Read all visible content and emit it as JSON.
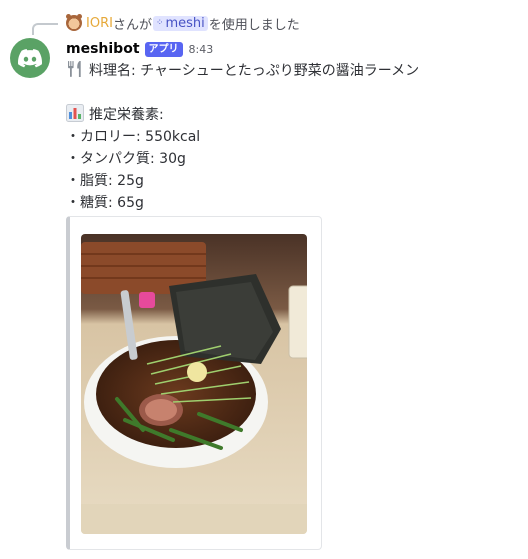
{
  "reply": {
    "user": "IORI",
    "text_before": "さんが",
    "command": "meshi",
    "text_after": "を使用しました"
  },
  "message": {
    "username": "meshibot",
    "badge": "アプリ",
    "timestamp": "8:43",
    "dish": "料理名: チャーシューとたっぷり野菜の醤油ラーメン",
    "nutrition_heading": "推定栄養素:",
    "nutrition": [
      "・カロリー: 550kcal",
      "・タンパク質: 30g",
      "・脂質: 25g",
      "・糖質: 65g"
    ]
  },
  "embed": {
    "image_icon": "ramen-photo"
  },
  "colors": {
    "avatar_bg": "#5aa265",
    "badge_bg": "#5865f2",
    "reply_user": "#e6a93a",
    "command_bg": "#e0e3ff",
    "command_text": "#4752c4"
  }
}
